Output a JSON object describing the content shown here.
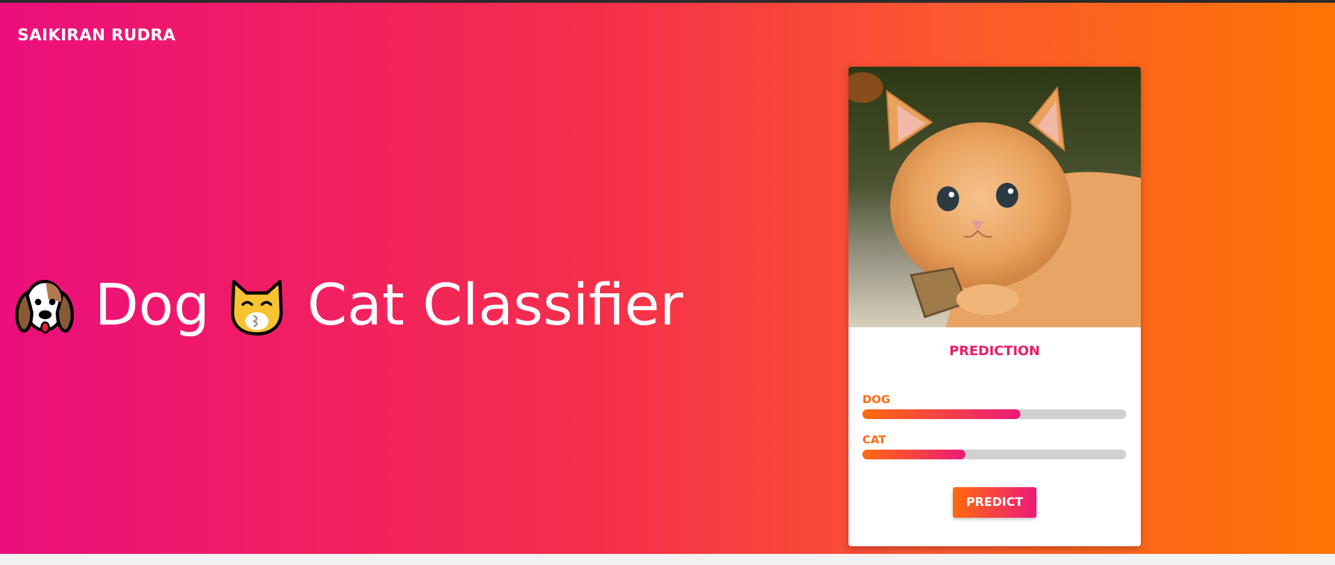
{
  "brand": {
    "name": "SAIKIRAN RUDRA"
  },
  "hero": {
    "title_word_1": "Dog",
    "title_word_2": "Cat Classifier",
    "icon_1": "dog-face-icon",
    "icon_2": "kissing-cat-icon"
  },
  "card": {
    "image": {
      "subject": "orange-kitten-photo"
    },
    "prediction_title": "PREDICTION",
    "bars": [
      {
        "label": "DOG",
        "fraction": 0.6
      },
      {
        "label": "CAT",
        "fraction": 0.39
      }
    ],
    "predict_label": "PREDICT"
  },
  "colors": {
    "gradient_left": "#ec0e7c",
    "gradient_right": "#ff7405",
    "accent_pink": "#ec1a6a",
    "accent_orange": "#ff6a12",
    "bar_track": "#d0d0d0"
  }
}
